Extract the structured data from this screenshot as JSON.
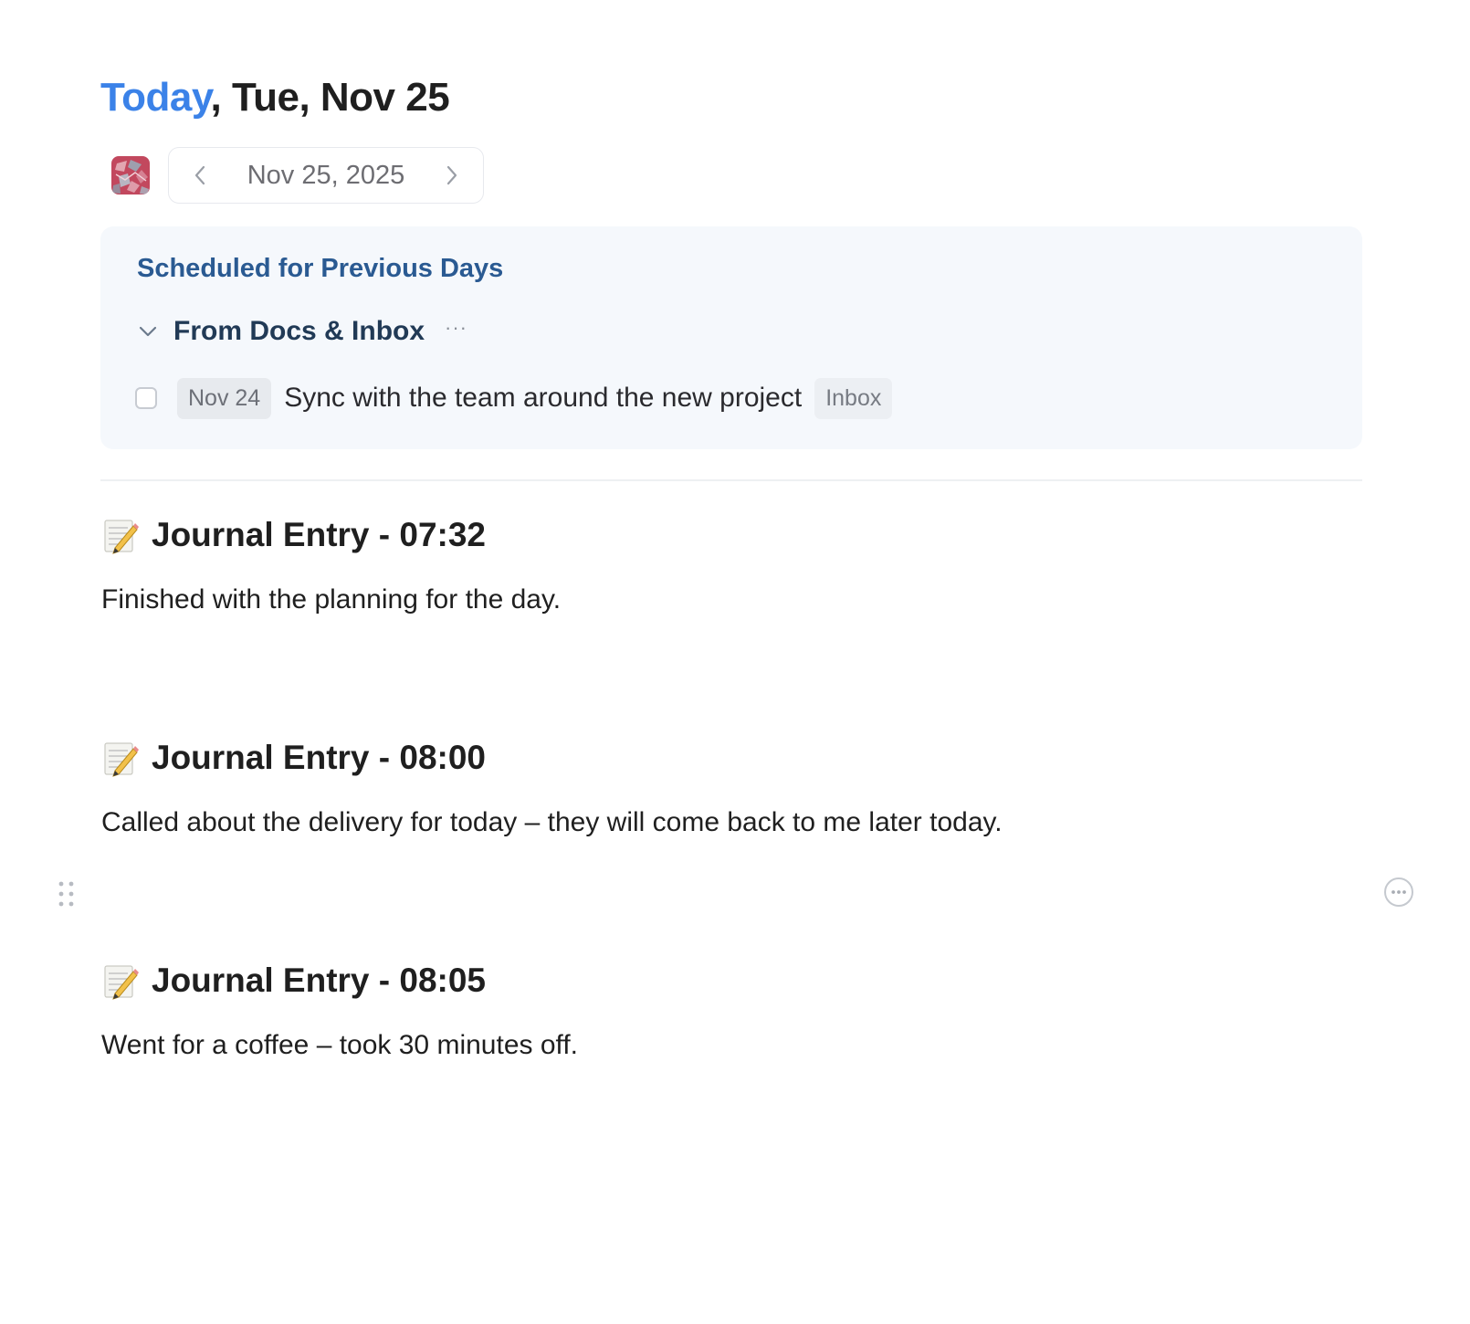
{
  "header": {
    "title_highlight": "Today",
    "title_rest": ", Tue, Nov 25"
  },
  "date_nav": {
    "current_date": "Nov 25, 2025",
    "prev_icon": "chevron-left-icon",
    "next_icon": "chevron-right-icon"
  },
  "previous_days": {
    "title": "Scheduled for Previous Days",
    "groups": [
      {
        "label": "From Docs & Inbox",
        "more_label": "···",
        "tasks": [
          {
            "date": "Nov 24",
            "text": "Sync with the team around the new project",
            "tag": "Inbox",
            "completed": false
          }
        ]
      }
    ]
  },
  "journal": [
    {
      "icon": "memo-icon",
      "title": "Journal Entry - 07:32",
      "body": "Finished with the planning for the day."
    },
    {
      "icon": "memo-icon",
      "title": "Journal Entry - 08:00",
      "body": "Called about the delivery for today – they will come back to me later today."
    },
    {
      "icon": "memo-icon",
      "title": "Journal Entry - 08:05",
      "body": "Went for a coffee – took 30 minutes off."
    }
  ],
  "colors": {
    "accent": "#3b82e8",
    "section_title": "#2a5a92",
    "panel_bg": "#f5f8fc"
  }
}
